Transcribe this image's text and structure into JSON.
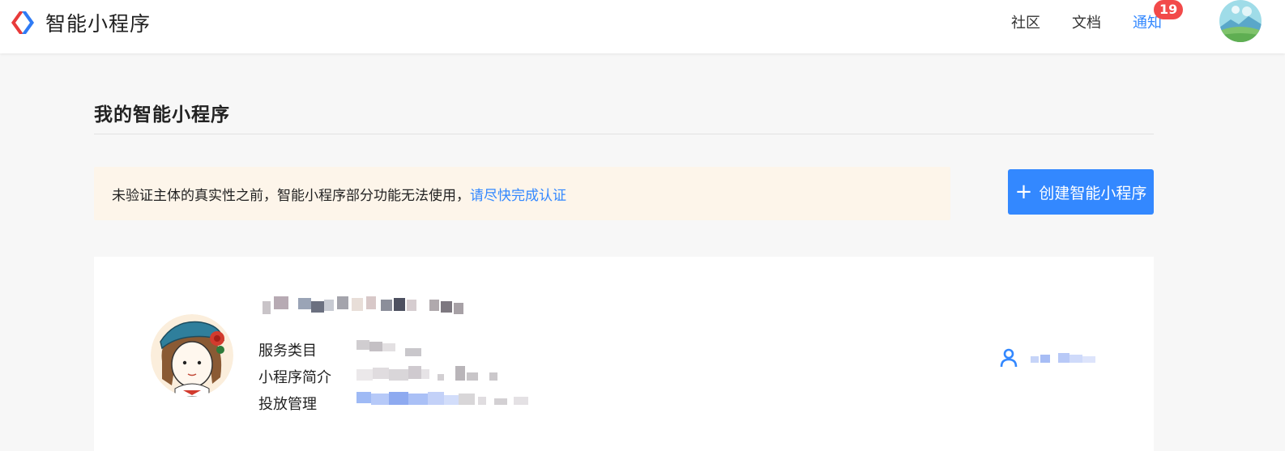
{
  "header": {
    "brand_name": "智能小程序",
    "nav": {
      "community": "社区",
      "docs": "文档",
      "notifications": "通知",
      "notification_count": "19"
    }
  },
  "main": {
    "title": "我的智能小程序",
    "notice": {
      "text": "未验证主体的真实性之前，智能小程序部分功能无法使用，",
      "link": "请尽快完成认证"
    },
    "create_button": "创建智能小程序",
    "app_card": {
      "labels": {
        "category": "服务类目",
        "intro": "小程序简介",
        "placement": "投放管理"
      }
    }
  },
  "colors": {
    "accent": "#3388ff",
    "badge": "#f24a4a",
    "notice_bg": "#fdf5ea"
  },
  "icons": {
    "brand_logo": "brand-logo-icon",
    "plus": "plus-icon",
    "member": "user-icon"
  }
}
